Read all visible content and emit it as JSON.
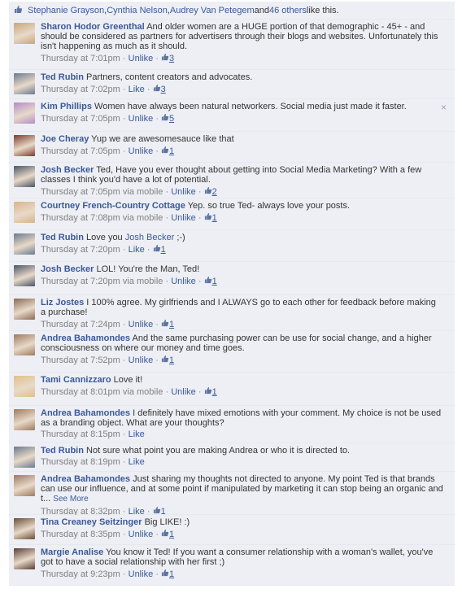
{
  "likes_bar": {
    "names": [
      "Stephanie Grayson",
      "Cynthia Nelson",
      "Audrey Van Petegem"
    ],
    "sep": ", ",
    "and": " and ",
    "others": "46 others",
    "suffix": " like this.",
    "icon": "thumbs-up-icon"
  },
  "comments": [
    {
      "author": "Sharon Hodor Greenthal",
      "text": "And older women are a HUGE portion of that demographic - 45+ - and should be considered as partners for advertisers through their blogs and websites. Unfortunately this isn't happening as much as it should.",
      "time": "Thursday at 7:01pm",
      "action": "Unlike",
      "likes": "3",
      "avatar_color": "#c9a57a"
    },
    {
      "author": "Ted Rubin",
      "text": "Partners, content creators and advocates.",
      "time": "Thursday at 7:02pm",
      "action": "Like",
      "likes": "3",
      "avatar_color": "#6b7a8f"
    },
    {
      "author": "Kim Phillips",
      "text": "Women have always been natural networkers. Social media just made it faster.",
      "time": "Thursday at 7:05pm",
      "action": "Unlike",
      "likes": "5",
      "avatar_color": "#b48cc8",
      "close": "×"
    },
    {
      "author": "Joe Cheray",
      "text": "Yup we are awesomesauce like that",
      "time": "Thursday at 7:05pm",
      "action": "Unlike",
      "likes": "1",
      "avatar_color": "#7a3b2e"
    },
    {
      "author": "Josh Becker",
      "text": "Ted, Have you ever thought about getting into Social Media Marketing? With a few classes I think you'd have a lot of potential.",
      "time": "Thursday at 7:05pm via mobile",
      "action": "Unlike",
      "likes": "2",
      "avatar_color": "#4a5566"
    },
    {
      "author": "Courtney French-Country Cottage",
      "text": "Yep. so true Ted- always love your posts.",
      "time": "Thursday at 7:08pm via mobile",
      "action": "Unlike",
      "likes": "1",
      "avatar_color": "#d8b48a"
    },
    {
      "author": "Ted Rubin",
      "text": "Love you Josh Becker ;-)",
      "mention": "Josh Becker",
      "time": "Thursday at 7:20pm",
      "action": "Like",
      "likes": "1",
      "avatar_color": "#6b7a8f"
    },
    {
      "author": "Josh Becker",
      "text": "LOL! You're the Man, Ted!",
      "time": "Thursday at 7:20pm via mobile",
      "action": "Unlike",
      "likes": "1",
      "avatar_color": "#4a5566"
    },
    {
      "author": "Liz Jostes",
      "text": "I 100% agree. My girlfriends and I ALWAYS go to each other for feedback before making a purchase!",
      "time": "Thursday at 7:24pm",
      "action": "Unlike",
      "likes": "1",
      "avatar_color": "#8a6b55"
    },
    {
      "author": "Andrea Bahamondes",
      "text": "And the same purchasing power can be use for social change, and a higher consciousness on where our money and time goes.",
      "time": "Thursday at 7:52pm",
      "action": "Unlike",
      "likes": "1",
      "avatar_color": "#9c7a60"
    },
    {
      "author": "Tami Cannizzaro",
      "text": "Love it!",
      "time": "Thursday at 8:01pm via mobile",
      "action": "Unlike",
      "likes": "1",
      "avatar_color": "#e0c08a"
    },
    {
      "author": "Andrea Bahamondes",
      "text": "I definitely have mixed emotions with your comment. My choice is not be used as a branding object. What are your thoughts?",
      "time": "Thursday at 8:15pm",
      "action": "Like",
      "likes": "",
      "avatar_color": "#9c7a60"
    },
    {
      "author": "Ted Rubin",
      "text": "Not sure what point you are making Andrea or who it is directed to.",
      "time": "Thursday at 8:19pm",
      "action": "Like",
      "likes": "",
      "avatar_color": "#6b7a8f"
    },
    {
      "author": "Andrea Bahamondes",
      "text": "Just sharing my thoughts not directed to anyone. My point Ted is that brands can use our influence, and at some point if manipulated by marketing it can stop being an organic and t...",
      "see_more": "See More",
      "time": "Thursday at 8:32pm",
      "action": "Like",
      "likes": "1",
      "avatar_color": "#9c7a60"
    },
    {
      "author": "Tina Creaney Seitzinger",
      "text": "Big LIKE! :)",
      "time": "Thursday at 8:35pm",
      "action": "Unlike",
      "likes": "1",
      "avatar_color": "#6a4d3a"
    },
    {
      "author": "Margie Analise",
      "text": "You know it Ted! If you want a consumer relationship with a woman's wallet, you've got to have a social relationship with her first ;)",
      "time": "Thursday at 9:23pm",
      "action": "Unlike",
      "likes": "1",
      "avatar_color": "#5a3d35"
    }
  ]
}
